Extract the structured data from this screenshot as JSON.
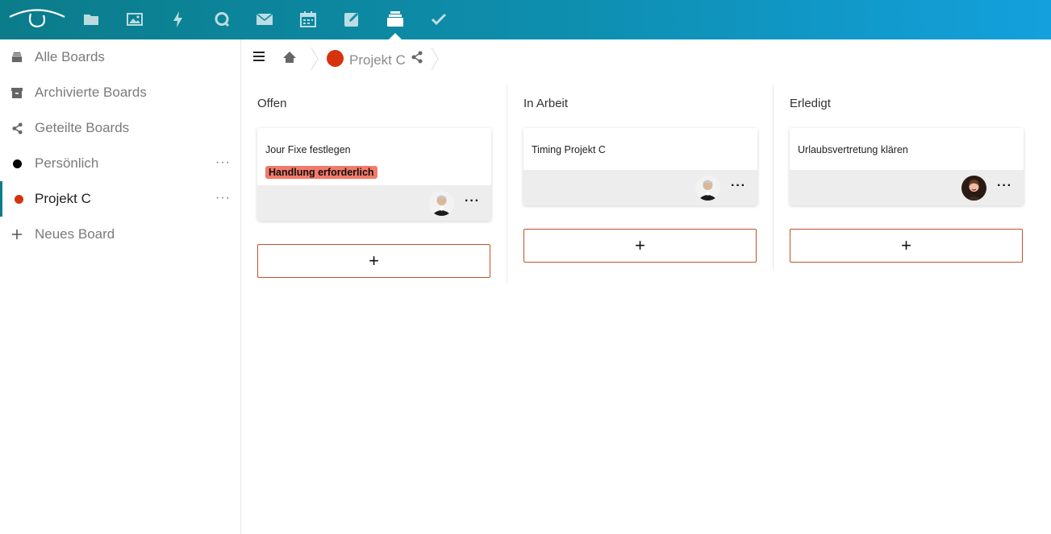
{
  "header": {
    "apps": [
      {
        "icon": "files-icon"
      },
      {
        "icon": "gallery-icon"
      },
      {
        "icon": "activity-icon"
      },
      {
        "icon": "talk-icon"
      },
      {
        "icon": "mail-icon"
      },
      {
        "icon": "calendar-icon"
      },
      {
        "icon": "notes-icon"
      },
      {
        "icon": "deck-icon",
        "active": true
      },
      {
        "icon": "tasks-icon"
      }
    ]
  },
  "sidebar": {
    "items": [
      {
        "label": "Alle Boards",
        "icon": "stack-icon"
      },
      {
        "label": "Archivierte Boards",
        "icon": "archive-icon"
      },
      {
        "label": "Geteilte Boards",
        "icon": "share-icon"
      },
      {
        "label": "Persönlich",
        "color": "#000000",
        "more": "···"
      },
      {
        "label": "Projekt C",
        "color": "#d6330d",
        "more": "···",
        "active": true
      },
      {
        "label": "Neues Board",
        "icon": "plus-icon"
      }
    ]
  },
  "breadcrumb": {
    "board_name": "Projekt C",
    "board_color": "#d6330d"
  },
  "stacks": [
    {
      "title": "Offen",
      "cards": [
        {
          "title": "Jour Fixe festlegen",
          "label": "Handlung erforderlich",
          "label_color": "#f27a6a",
          "more": "···"
        }
      ],
      "add": "+"
    },
    {
      "title": "In Arbeit",
      "cards": [
        {
          "title": "Timing Projekt C",
          "more": "···"
        }
      ],
      "add": "+"
    },
    {
      "title": "Erledigt",
      "cards": [
        {
          "title": "Urlaubsvertretung klären",
          "more": "···"
        }
      ],
      "add": "+"
    }
  ],
  "colors": {
    "accent": "#0b7c8a",
    "header_end": "#13a0dc",
    "add_border": "#c0512a"
  }
}
